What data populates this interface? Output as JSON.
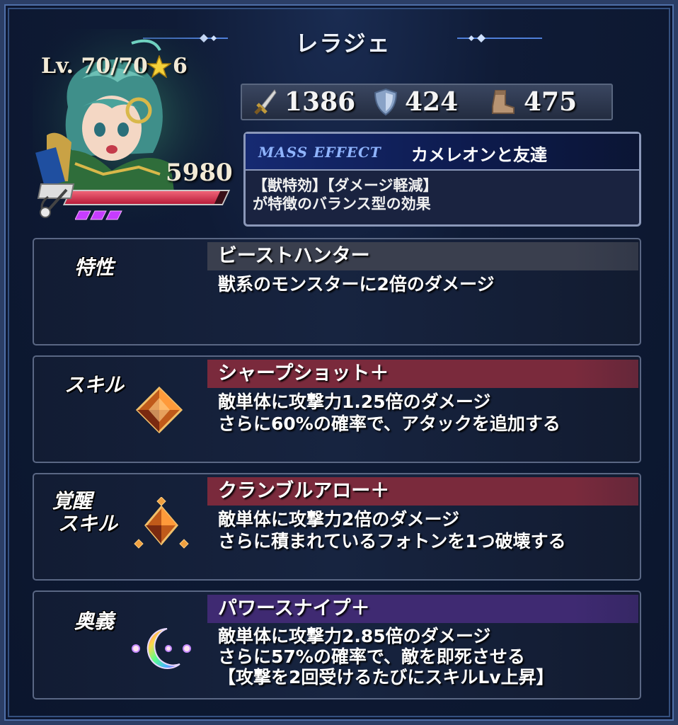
{
  "title": "レラジェ",
  "unit": {
    "level": "Lv. 70/70",
    "rarity": "6",
    "hp": "5980",
    "hp_fraction": 0.95,
    "gauge_count": 3
  },
  "stats": {
    "attack": "1386",
    "defense": "424",
    "speed": "475"
  },
  "mass_effect": {
    "label": "MASS EFFECT",
    "name": "カメレオンと友達",
    "desc_line1": "【獣特効】【ダメージ軽減】",
    "desc_line2": "が特徴のバランス型の効果"
  },
  "sections": {
    "trait": {
      "label": "特性",
      "name": "ビーストハンター",
      "desc_line1": "獣系のモンスターに2倍のダメージ",
      "bar_color": "#3a3f4e"
    },
    "skill": {
      "label": "スキル",
      "name": "シャープショット＋",
      "desc_line1": "敵単体に攻撃力1.25倍のダメージ",
      "desc_line2": "さらに60%の確率で、アタックを追加する",
      "bar_color": "#7a2a3c"
    },
    "awaken": {
      "label_line1": "覚醒",
      "label_line2": "スキル",
      "name": "クランブルアロー＋",
      "desc_line1": "敵単体に攻撃力2倍のダメージ",
      "desc_line2": "さらに積まれているフォトンを1つ破壊する",
      "bar_color": "#7a2a3c"
    },
    "ultimate": {
      "label": "奥義",
      "name": "パワースナイプ＋",
      "desc_line1": "敵単体に攻撃力2.85倍のダメージ",
      "desc_line2": "さらに57%の確率で、敵を即死させる",
      "desc_line3": "【攻撃を2回受けるたびにスキルLv上昇】",
      "bar_color": "#3f2a72"
    }
  }
}
